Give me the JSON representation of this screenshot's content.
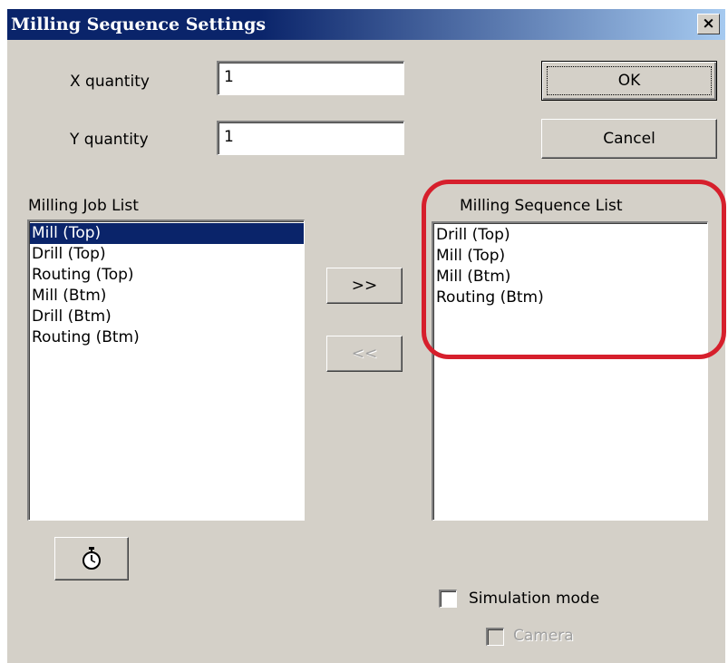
{
  "window": {
    "title": "Milling Sequence Settings",
    "close_glyph": "×"
  },
  "fields": {
    "x_quantity": {
      "label": "X quantity",
      "value": "1"
    },
    "y_quantity": {
      "label": "Y quantity",
      "value": "1"
    }
  },
  "buttons": {
    "ok": "OK",
    "cancel": "Cancel",
    "add": ">>",
    "remove": "<<",
    "timer_icon": "stopwatch-icon"
  },
  "job_list": {
    "label": "Milling Job List",
    "selected_index": 0,
    "items": [
      "Mill (Top)",
      "Drill (Top)",
      "Routing (Top)",
      "Mill (Btm)",
      "Drill (Btm)",
      "Routing (Btm)"
    ]
  },
  "sequence_list": {
    "label": "Milling Sequence List",
    "items": [
      "Drill (Top)",
      "Mill (Top)",
      "Mill (Btm)",
      "Routing (Btm)"
    ]
  },
  "options": {
    "simulation_mode": {
      "label": "Simulation mode",
      "checked": false
    },
    "camera": {
      "label": "Camera",
      "checked": false,
      "enabled": false
    }
  },
  "colors": {
    "dialog_bg": "#d4d0c8",
    "title_bar": "#0a246a",
    "selection": "#0a246a",
    "annotation_circle": "#d61f2c"
  }
}
